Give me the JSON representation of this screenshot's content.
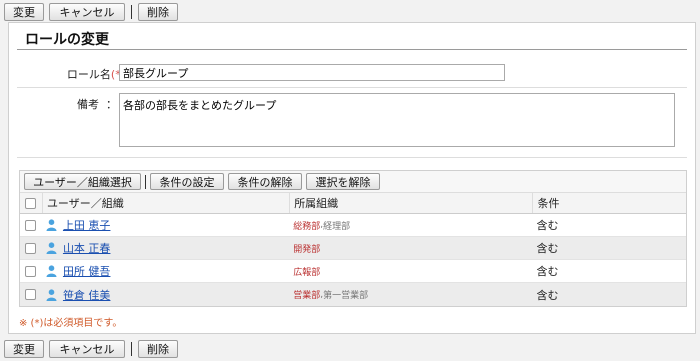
{
  "toolbar": {
    "edit": "変更",
    "cancel": "キャンセル",
    "delete": "削除"
  },
  "page_title": "ロールの変更",
  "form": {
    "role_name_label": "ロール名",
    "required_mark": "(*)",
    "colon": "：",
    "role_name_value": "部長グループ",
    "remarks_label": "備考",
    "remarks_value": "各部の部長をまとめたグループ"
  },
  "grid": {
    "buttons": {
      "select": "ユーザー／組織選択",
      "cond_set": "条件の設定",
      "cond_clear": "条件の解除",
      "unselect": "選択を解除"
    },
    "headers": {
      "user": "ユーザー／組織",
      "org": "所属組織",
      "cond": "条件"
    },
    "rows": [
      {
        "name": "上田 恵子",
        "org_main": "総務部",
        "org_sub": "経理部",
        "cond": "含む"
      },
      {
        "name": "山本 正春",
        "org_main": "開発部",
        "org_sub": "",
        "cond": "含む"
      },
      {
        "name": "田所 健吾",
        "org_main": "広報部",
        "org_sub": "",
        "cond": "含む"
      },
      {
        "name": "笹倉 佳美",
        "org_main": "営業部",
        "org_sub": "第一営業部",
        "cond": "含む"
      }
    ]
  },
  "footnote": "※ (*)は必須項目です。",
  "colors": {
    "link": "#1a4fb0",
    "required": "#d9534f",
    "org": "#bb3333"
  },
  "icons": {
    "user": "user-icon"
  }
}
